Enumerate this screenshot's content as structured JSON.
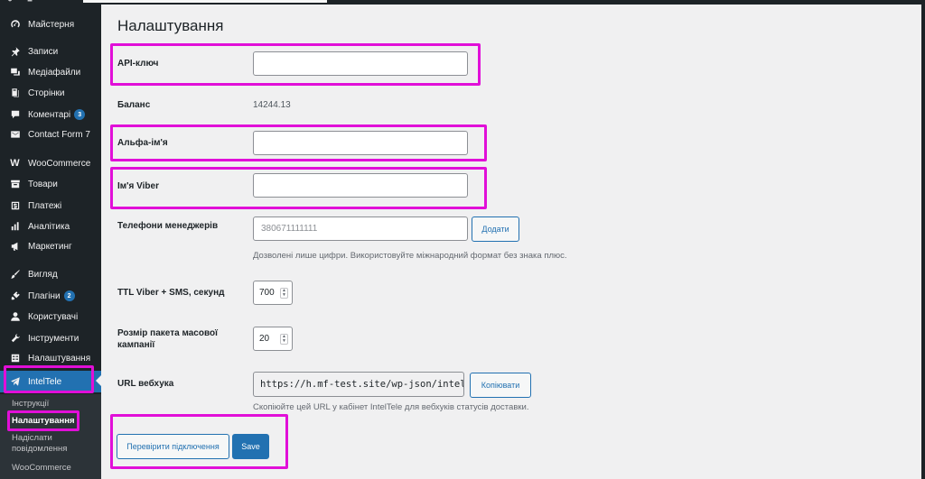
{
  "sidebar": {
    "items": [
      {
        "label": "Майстерня",
        "icon": "dashboard-icon"
      },
      {
        "label": "Записи",
        "icon": "pin-icon"
      },
      {
        "label": "Медіафайли",
        "icon": "media-icon"
      },
      {
        "label": "Сторінки",
        "icon": "pages-icon"
      },
      {
        "label": "Коментарі",
        "icon": "comments-icon",
        "badge": "3"
      },
      {
        "label": "Contact Form 7",
        "icon": "mail-icon"
      },
      {
        "label": "WooCommerce",
        "icon": "woocommerce-icon"
      },
      {
        "label": "Товари",
        "icon": "archive-icon"
      },
      {
        "label": "Платежі",
        "icon": "payments-icon"
      },
      {
        "label": "Аналітика",
        "icon": "chart-icon"
      },
      {
        "label": "Маркетинг",
        "icon": "megaphone-icon"
      },
      {
        "label": "Вигляд",
        "icon": "brush-icon"
      },
      {
        "label": "Плагіни",
        "icon": "plugin-icon",
        "badge": "2"
      },
      {
        "label": "Користувачі",
        "icon": "users-icon"
      },
      {
        "label": "Інструменти",
        "icon": "wrench-icon"
      },
      {
        "label": "Налаштування",
        "icon": "settings-icon"
      },
      {
        "label": "IntelTele",
        "icon": "inteltele-icon"
      }
    ],
    "submenu": [
      {
        "label": "Інструкції"
      },
      {
        "label": "Налаштування"
      },
      {
        "label": "Надіслати повідомлення"
      },
      {
        "label": "WooCommerce"
      }
    ]
  },
  "main": {
    "title": "Налаштування",
    "api_key": {
      "label": "API-ключ",
      "value": ""
    },
    "balance": {
      "label": "Баланс",
      "value": "14244.13"
    },
    "alpha_name": {
      "label": "Альфа-ім'я",
      "value": ""
    },
    "viber_name": {
      "label": "Ім'я Viber",
      "value": ""
    },
    "managers_phones": {
      "label": "Телефони менеджерів",
      "placeholder": "380671111111",
      "add_label": "Додати",
      "description": "Дозволені лише цифри. Використовуйте міжнародний формат без знака плюс."
    },
    "ttl": {
      "label": "TTL Viber + SMS, секунд",
      "value": "700"
    },
    "batch_size": {
      "label": "Розмір пакета масової кампанії",
      "value": "20"
    },
    "webhook": {
      "label": "URL вебхука",
      "value": "https://h.mf-test.site/wp-json/inteltele/v",
      "copy_label": "Копіювати",
      "description": "Скопіюйте цей URL у кабінет IntelTele для вебхуків статусів доставки."
    },
    "check_connection_label": "Перевірити підключення",
    "save_label": "Save"
  },
  "colors": {
    "highlight": "#e10fd8",
    "wp_blue": "#2271b1",
    "sidebar_bg": "#1d2327"
  }
}
